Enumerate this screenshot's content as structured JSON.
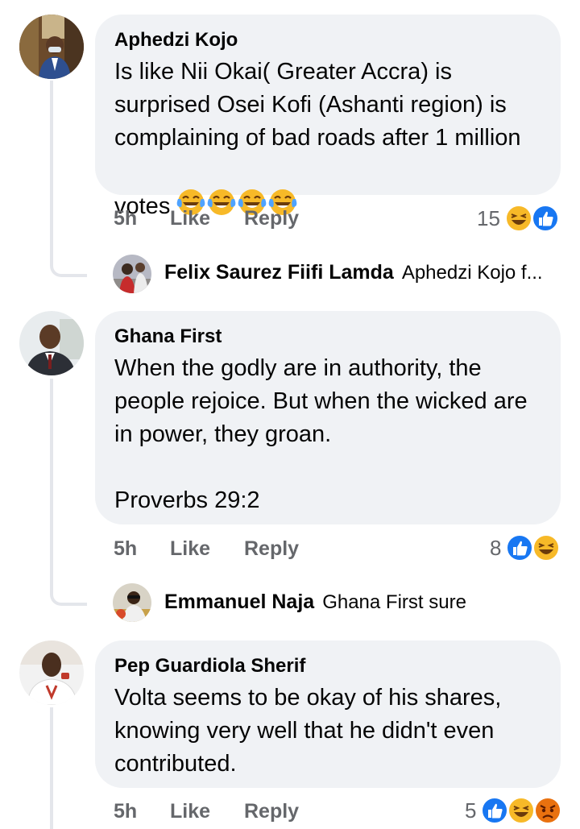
{
  "comments": [
    {
      "author": "Aphedzi Kojo",
      "text": "Is like Nii Okai( Greater Accra) is surprised Osei Kofi (Ashanti region) is complaining of bad roads after 1 million votes",
      "time": "5h",
      "like": "Like",
      "reply": "Reply",
      "reaction_count": "15",
      "reactions": [
        "haha-icon",
        "like-icon"
      ],
      "inline_emojis": [
        "tears-of-joy-emoji",
        "tears-of-joy-emoji",
        "tears-of-joy-emoji",
        "tears-of-joy-emoji"
      ],
      "reply_preview": {
        "author": "Felix Saurez Fiifi Lamda",
        "text": "Aphedzi Kojo f..."
      }
    },
    {
      "author": "Ghana First",
      "text": "When the godly are in authority, the people rejoice. But when the wicked are in power, they groan.\n\nProverbs 29:2",
      "time": "5h",
      "like": "Like",
      "reply": "Reply",
      "reaction_count": "8",
      "reactions": [
        "like-icon",
        "haha-icon"
      ],
      "reply_preview": {
        "author": "Emmanuel Naja",
        "text": "Ghana First sure"
      }
    },
    {
      "author": "Pep Guardiola Sherif",
      "text": "Volta seems to be okay of his shares, knowing very well that he didn't even contributed.",
      "time": "5h",
      "like": "Like",
      "reply": "Reply",
      "reaction_count": "5",
      "reactions": [
        "like-icon",
        "haha-icon",
        "angry-icon"
      ]
    }
  ],
  "colors": {
    "bubble": "#f0f2f5",
    "meta": "#65676b",
    "like_blue": "#1877f2",
    "haha_yellow": "#f7b928",
    "angry_orange": "#e9710f"
  }
}
